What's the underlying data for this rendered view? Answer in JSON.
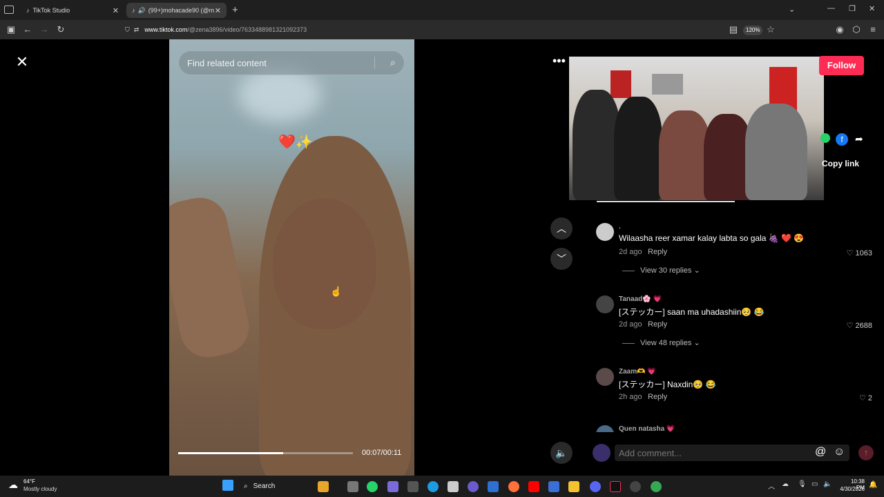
{
  "browser": {
    "tabs": [
      {
        "label": "TikTok Studio"
      },
      {
        "label": "(99+)mohacade90 (@moh..."
      }
    ],
    "url_host": "www.tiktok.com",
    "url_path": "/@zena3896/video/7633488981321092373",
    "zoom": "120%"
  },
  "video": {
    "search_placeholder": "Find related content",
    "timecode": "00:07/00:11",
    "progress": 0.6
  },
  "side": {
    "follow_label": "Follow",
    "copy_link_label": "Copy link"
  },
  "comments": [
    {
      "user": ".",
      "text": "Wilaasha reer xamar kalay labta so gala 🍇 ❤️ 😍",
      "time": "2d ago",
      "reply": "Reply",
      "likes": "1063",
      "view_replies": "View 30 replies"
    },
    {
      "user": "Tanaad🌸 💗",
      "text": "[ステッカー] saan ma uhadashiin🥺 😂",
      "time": "2d ago",
      "reply": "Reply",
      "likes": "2688",
      "view_replies": "View 48 replies"
    },
    {
      "user": "Zaam🫶 💗",
      "text": "[ステッカー] Naxdin🥺 😂",
      "time": "2h ago",
      "reply": "Reply",
      "likes": "2",
      "view_replies": ""
    },
    {
      "user": "Quen natasha 💗",
      "text": "",
      "time": "",
      "reply": "",
      "likes": "",
      "view_replies": ""
    }
  ],
  "comment_bar": {
    "placeholder": "Add comment..."
  },
  "taskbar": {
    "weather_temp": "64°F",
    "weather_desc": "Mostly cloudy",
    "search_label": "Search",
    "time": "10:38 PM",
    "date": "4/30/2026"
  }
}
